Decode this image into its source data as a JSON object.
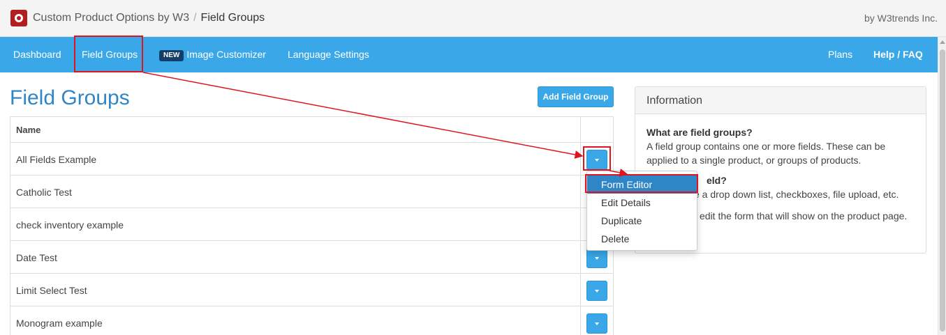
{
  "header": {
    "app_name": "Custom Product Options by W3",
    "separator": "/",
    "current_page": "Field Groups",
    "company": "by W3trends Inc."
  },
  "nav": {
    "dashboard": "Dashboard",
    "field_groups": "Field Groups",
    "new_badge": "NEW",
    "image_customizer": "Image Customizer",
    "language_settings": "Language Settings",
    "plans": "Plans",
    "help": "Help / FAQ"
  },
  "main": {
    "title": "Field Groups",
    "add_button": "Add Field Group",
    "table": {
      "column_name": "Name",
      "rows": [
        "All Fields Example",
        "Catholic Test",
        "check inventory example",
        "Date Test",
        "Limit Select Test",
        "Monogram example"
      ]
    }
  },
  "dropdown": {
    "items": [
      "Form Editor",
      "Edit Details",
      "Duplicate",
      "Delete"
    ],
    "active_item": "Form Editor"
  },
  "info": {
    "title": "Information",
    "q1": "What are field groups?",
    "a1": "A field group contains one or more fields. These can be applied to a single product, or groups of products.",
    "q2_visible": "eld?",
    "a2_visible": "e a drop down list, checkboxes, file upload, etc.",
    "a3_visible": "edit the form that will show on the product page."
  },
  "colors": {
    "nav_background": "#3aa8e8",
    "title_blue": "#2f86c7",
    "badge_navy": "#123f6a",
    "annotation_red": "#e0141e",
    "logo_red": "#b31d1d"
  }
}
